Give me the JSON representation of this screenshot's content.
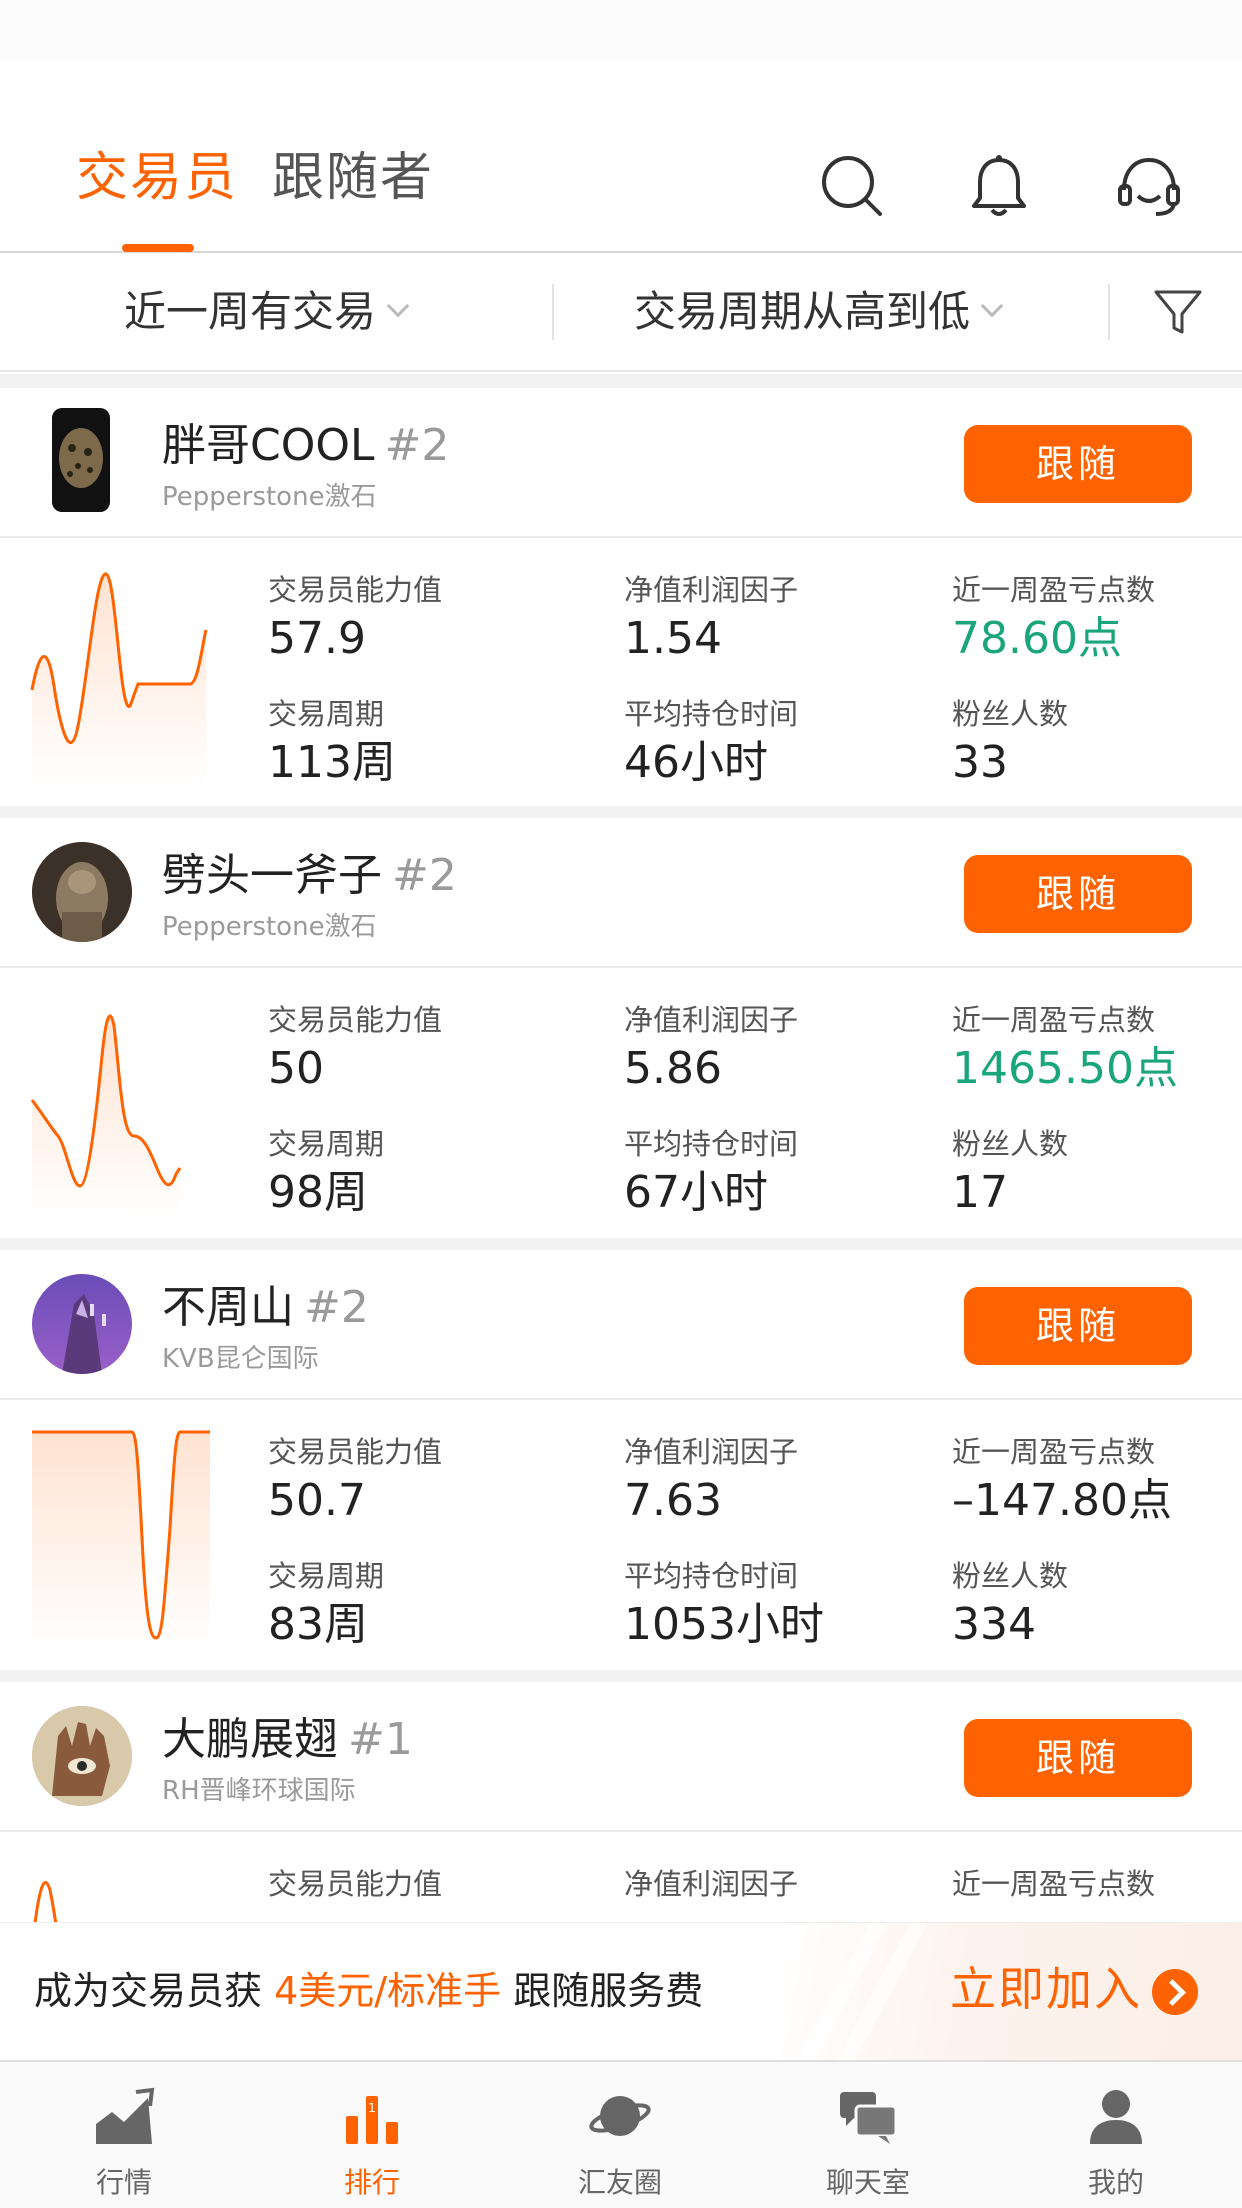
{
  "header": {
    "tabs": [
      {
        "label": "交易员",
        "active": true
      },
      {
        "label": "跟随者",
        "active": false
      }
    ],
    "icons": [
      "search-icon",
      "bell-icon",
      "headset-icon"
    ]
  },
  "filters": {
    "time": "近一周有交易",
    "sort": "交易周期从高到低",
    "funnel_icon": "filter-icon"
  },
  "labels": {
    "ability": "交易员能力值",
    "profit_factor": "净值利润因子",
    "weekly_points": "近一周盈亏点数",
    "period": "交易周期",
    "avg_hold": "平均持仓时间",
    "fans": "粉丝人数",
    "follow": "跟随"
  },
  "traders": [
    {
      "name": "胖哥COOL",
      "rank": "#2",
      "broker": "Pepperstone激石",
      "ability": "57.9",
      "profit_factor": "1.54",
      "weekly_points": "78.60点",
      "weekly_positive": true,
      "period": "113周",
      "avg_hold": "46小时",
      "fans": "33"
    },
    {
      "name": "劈头一斧子",
      "rank": "#2",
      "broker": "Pepperstone激石",
      "ability": "50",
      "profit_factor": "5.86",
      "weekly_points": "1465.50点",
      "weekly_positive": true,
      "period": "98周",
      "avg_hold": "67小时",
      "fans": "17"
    },
    {
      "name": "不周山",
      "rank": "#2",
      "broker": "KVB昆仑国际",
      "ability": "50.7",
      "profit_factor": "7.63",
      "weekly_points": "–147.80点",
      "weekly_positive": false,
      "period": "83周",
      "avg_hold": "1053小时",
      "fans": "334"
    },
    {
      "name": "大鹏展翅",
      "rank": "#1",
      "broker": "RH晋峰环球国际",
      "ability": "",
      "profit_factor": "",
      "weekly_points": "",
      "weekly_positive": true,
      "period": "",
      "avg_hold": "",
      "fans": ""
    }
  ],
  "promo": {
    "prefix": "成为交易员获",
    "highlight": "4美元/标准手",
    "suffix": "跟随服务费",
    "cta": "立即加入"
  },
  "bottom_nav": [
    {
      "label": "行情",
      "icon": "market-chart-icon",
      "active": false
    },
    {
      "label": "排行",
      "icon": "ranking-icon",
      "active": true
    },
    {
      "label": "汇友圈",
      "icon": "planet-icon",
      "active": false
    },
    {
      "label": "聊天室",
      "icon": "chat-icon",
      "active": false
    },
    {
      "label": "我的",
      "icon": "profile-icon",
      "active": false
    }
  ],
  "colors": {
    "accent": "#fe6201",
    "positive": "#1ba57b",
    "text": "#222222",
    "muted": "#9a9a9a"
  }
}
